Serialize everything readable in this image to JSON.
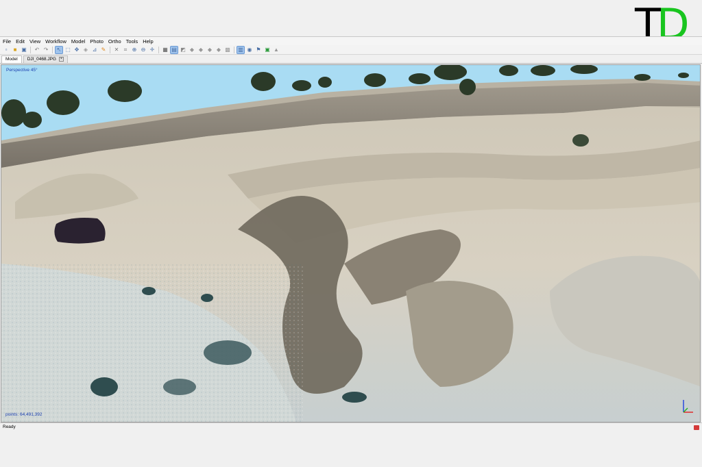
{
  "logo": {
    "letter1": "T",
    "letter2": "D"
  },
  "menu": [
    {
      "label": "File"
    },
    {
      "label": "Edit"
    },
    {
      "label": "View"
    },
    {
      "label": "Workflow"
    },
    {
      "label": "Model"
    },
    {
      "label": "Photo"
    },
    {
      "label": "Ortho"
    },
    {
      "label": "Tools"
    },
    {
      "label": "Help"
    }
  ],
  "toolbar": {
    "icons": [
      "new-icon",
      "open-icon",
      "save-icon",
      "undo-icon",
      "redo-icon",
      "pointer-icon",
      "rect-select-icon",
      "navigation-icon",
      "rotate-icon",
      "ruler-icon",
      "draw-icon",
      "delete-icon",
      "crop-icon",
      "zoom-in-icon",
      "zoom-out-icon",
      "reset-view-icon",
      "fit-icon",
      "grid-icon",
      "shading-icon",
      "point-cloud-icon",
      "dense-cloud-icon",
      "mesh-icon",
      "textured-icon",
      "tiled-icon",
      "dem-icon",
      "show-cameras-icon",
      "markers-icon",
      "shapes-icon",
      "ortho-icon",
      "settings-icon"
    ]
  },
  "tabs": [
    {
      "label": "Model"
    },
    {
      "label": "DJI_0468.JPG"
    }
  ],
  "viewport": {
    "perspective_label": "Perspective 45°",
    "points_label": "points: 64,491,392"
  },
  "status": {
    "text": "Ready"
  },
  "colors": {
    "sky": "#a9dcf3",
    "terrain": "#d6d0c2",
    "accent_blue": "#1b3fb0",
    "logo_green": "#19c51f"
  }
}
